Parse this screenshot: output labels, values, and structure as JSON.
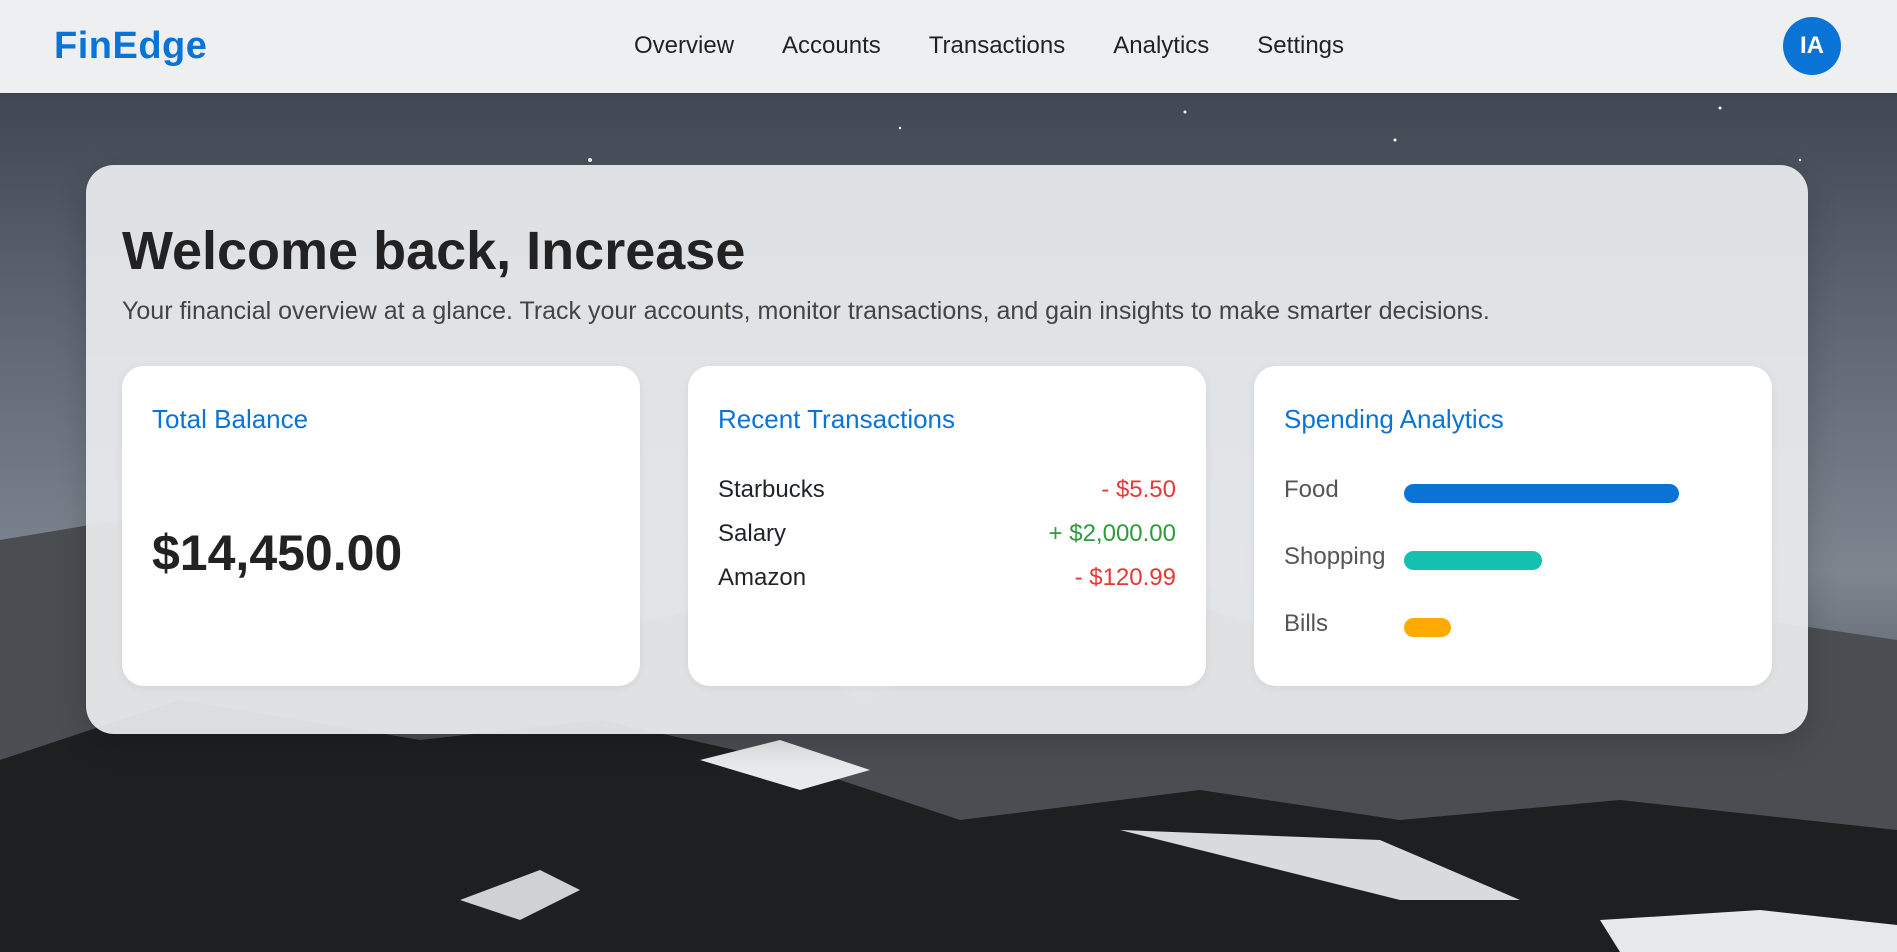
{
  "nav": {
    "brand": "FinEdge",
    "links": [
      "Overview",
      "Accounts",
      "Transactions",
      "Analytics",
      "Settings"
    ],
    "avatar_initials": "IA"
  },
  "hero": {
    "title": "Welcome back, Increase",
    "subtitle": "Your financial overview at a glance. Track your accounts, monitor transactions, and gain insights to make smarter decisions."
  },
  "balance_card": {
    "title": "Total Balance",
    "amount": "$14,450.00"
  },
  "transactions_card": {
    "title": "Recent Transactions",
    "items": [
      {
        "name": "Starbucks",
        "amount": "- $5.50",
        "type": "debit"
      },
      {
        "name": "Salary",
        "amount": "+ $2,000.00",
        "type": "credit"
      },
      {
        "name": "Amazon",
        "amount": "- $120.99",
        "type": "debit"
      }
    ]
  },
  "analytics_card": {
    "title": "Spending Analytics",
    "items": [
      {
        "label": "Food",
        "level": 1.0,
        "color": "#0a74d6"
      },
      {
        "label": "Shopping",
        "level": 0.5,
        "color": "#14c0b0"
      },
      {
        "label": "Bills",
        "level": 0.17,
        "color": "#ffaa00"
      }
    ]
  },
  "colors": {
    "accent": "#0a74d6",
    "debit": "#e53935",
    "credit": "#2e9b3c"
  }
}
